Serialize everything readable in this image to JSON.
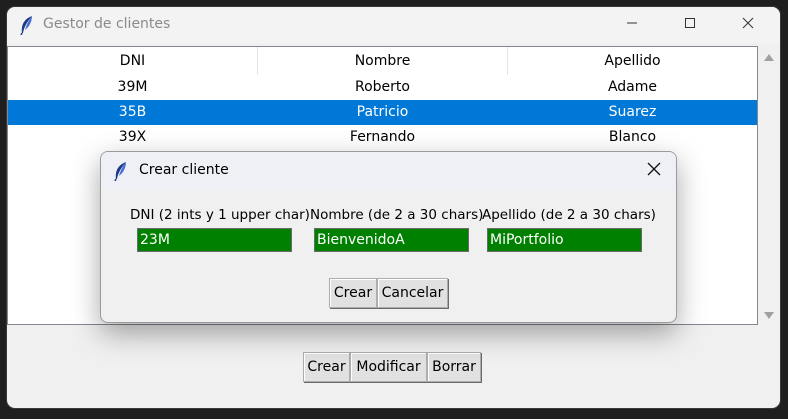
{
  "window": {
    "title": "Gestor de clientes"
  },
  "table": {
    "columns": [
      "DNI",
      "Nombre",
      "Apellido"
    ],
    "rows": [
      {
        "dni": "39M",
        "nombre": "Roberto",
        "apellido": "Adame",
        "selected": false
      },
      {
        "dni": "35B",
        "nombre": "Patricio",
        "apellido": "Suarez",
        "selected": true
      },
      {
        "dni": "39X",
        "nombre": "Fernando",
        "apellido": "Blanco",
        "selected": false
      }
    ]
  },
  "main_buttons": {
    "crear": "Crear",
    "modificar": "Modificar",
    "borrar": "Borrar"
  },
  "dialog": {
    "title": "Crear cliente",
    "fields": {
      "dni": {
        "label": "DNI (2 ints y 1 upper char)",
        "value": "23M"
      },
      "nombre": {
        "label": "Nombre (de 2 a 30 chars)",
        "value": "BienvenidoA"
      },
      "apellido": {
        "label": "Apellido (de 2 a 30 chars)",
        "value": "MiPortfolio"
      }
    },
    "buttons": {
      "crear": "Crear",
      "cancelar": "Cancelar"
    }
  },
  "colors": {
    "selection": "#0078d7",
    "valid_entry": "#008000"
  },
  "icons": {
    "app": "feather-icon",
    "minimize": "minimize-icon",
    "maximize": "maximize-icon",
    "close": "close-icon"
  }
}
